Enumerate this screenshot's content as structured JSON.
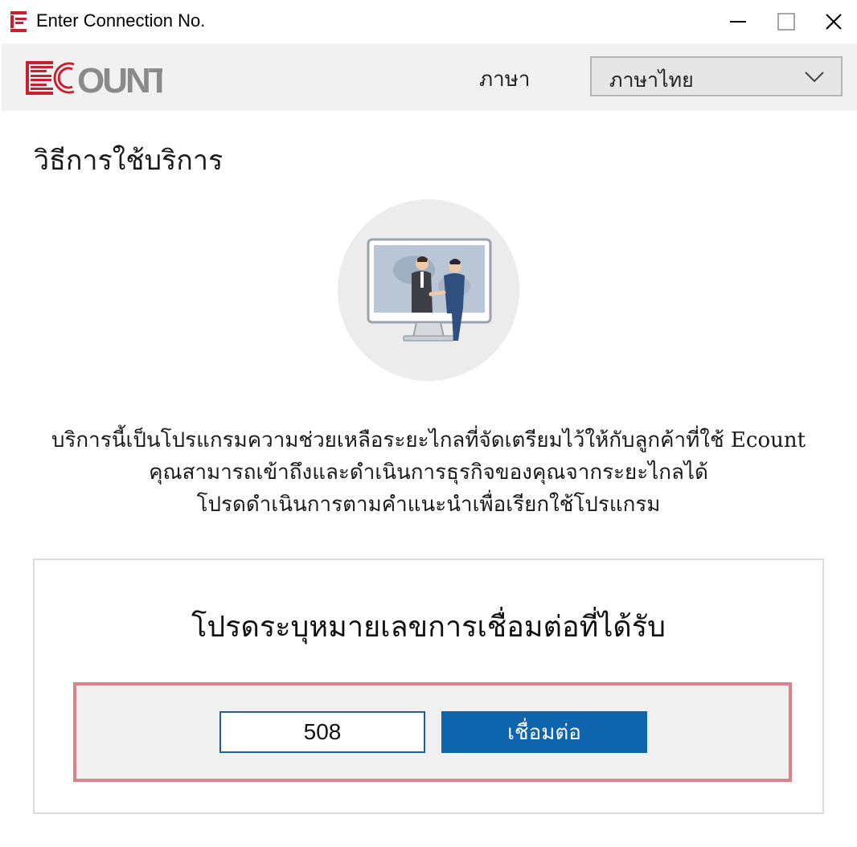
{
  "window": {
    "title": "Enter Connection No.",
    "icon": "ecount-e-icon",
    "controls": [
      "minimize-icon",
      "maximize-icon",
      "close-icon"
    ]
  },
  "header": {
    "logo_text": "ECOUNT",
    "language_label": "ภาษา",
    "language_value": "ภาษาไทย"
  },
  "section": {
    "title": "วิธีการใช้บริการ"
  },
  "description": {
    "lines": [
      "บริการนี้เป็นโปรแกรมความช่วยเหลือระยะไกลที่จัดเตรียมไว้ให้กับลูกค้าที่ใช้ Ecount",
      "คุณสามารถเข้าถึงและดำเนินการธุรกิจของคุณจากระยะไกลได้",
      "โปรดดำเนินการตามคำแนะนำเพื่อเรียกใช้โปรแกรม"
    ]
  },
  "connection": {
    "title": "โปรดระบุหมายเลขการเชื่อมต่อที่ได้รับ",
    "input_value": "508",
    "button_label": "เชื่อมต่อ"
  },
  "colors": {
    "brand_red": "#c8202f",
    "logo_gray": "#8a8a8a",
    "button_blue": "#0f64ae",
    "highlight_border": "#d9848a"
  }
}
